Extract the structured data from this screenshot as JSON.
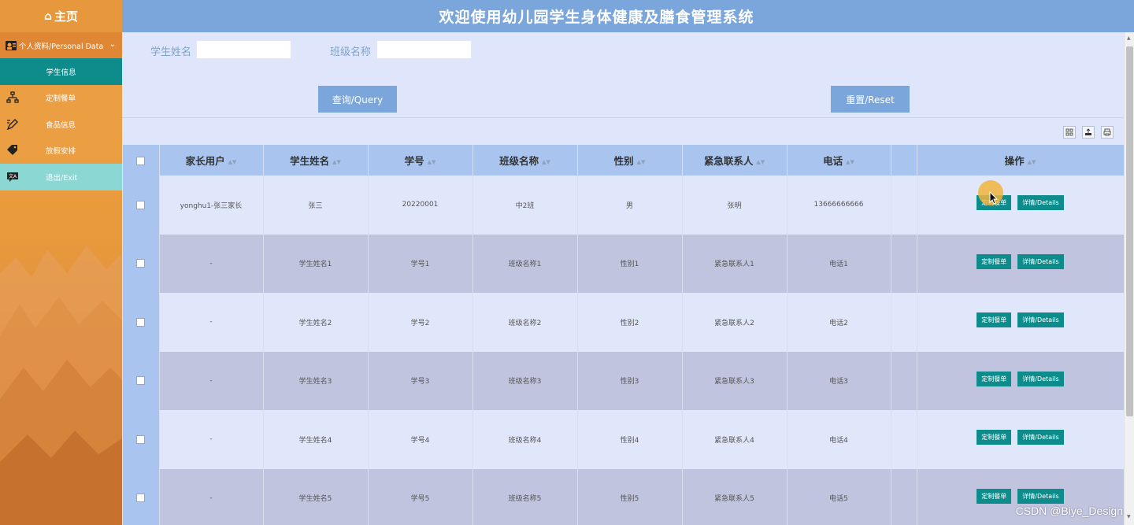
{
  "header": {
    "title": "欢迎使用幼儿园学生身体健康及膳食管理系统"
  },
  "sidebar": {
    "home_label": "主页",
    "section_label": "个人资料/Personal Data",
    "items": [
      {
        "label": "学生信息",
        "active": true
      },
      {
        "label": "定制餐单"
      },
      {
        "label": "食品信息"
      },
      {
        "label": "放假安排"
      },
      {
        "label": "退出/Exit"
      }
    ]
  },
  "search": {
    "student_name_label": "学生姓名",
    "student_name_value": "",
    "class_name_label": "班级名称",
    "class_name_value": "",
    "query_button": "查询/Query",
    "reset_button": "重置/Reset"
  },
  "table": {
    "columns": [
      "家长用户",
      "学生姓名",
      "学号",
      "班级名称",
      "性别",
      "紧急联系人",
      "电话",
      "",
      "操作"
    ],
    "action_labels": {
      "custom_menu": "定制餐单",
      "details": "详情/Details"
    },
    "rows": [
      [
        "yonghu1-张三家长",
        "张三",
        "20220001",
        "中2班",
        "男",
        "张明",
        "13666666666"
      ],
      [
        "-",
        "学生姓名1",
        "学号1",
        "班级名称1",
        "性别1",
        "紧急联系人1",
        "电话1"
      ],
      [
        "-",
        "学生姓名2",
        "学号2",
        "班级名称2",
        "性别2",
        "紧急联系人2",
        "电话2"
      ],
      [
        "-",
        "学生姓名3",
        "学号3",
        "班级名称3",
        "性别3",
        "紧急联系人3",
        "电话3"
      ],
      [
        "-",
        "学生姓名4",
        "学号4",
        "班级名称4",
        "性别4",
        "紧急联系人4",
        "电话4"
      ],
      [
        "-",
        "学生姓名5",
        "学号5",
        "班级名称5",
        "性别5",
        "紧急联系人5",
        "电话5"
      ]
    ]
  },
  "watermark": "CSDN @Biye_Design",
  "colors": {
    "accent_teal": "#0e8c8c",
    "header_blue": "#7aa6dc",
    "sidebar_orange": "#e89a3c"
  }
}
